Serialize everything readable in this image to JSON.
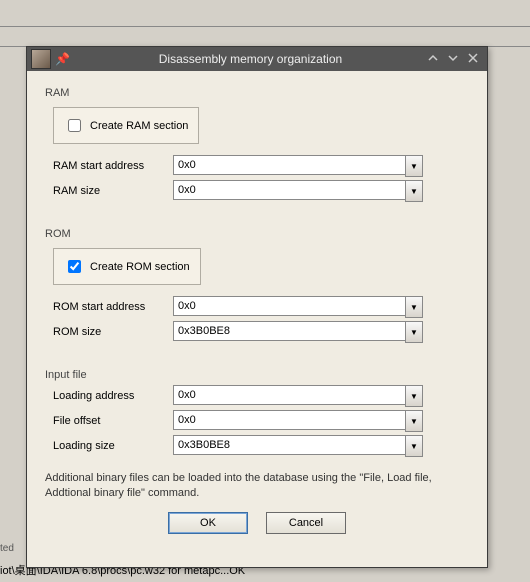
{
  "dialog": {
    "title": "Disassembly memory organization",
    "ram": {
      "label": "RAM",
      "create_label": "Create RAM section",
      "create_checked": false,
      "start_label": "RAM start address",
      "start_value": "0x0",
      "size_label": "RAM size",
      "size_value": "0x0"
    },
    "rom": {
      "label": "ROM",
      "create_label": "Create ROM section",
      "create_checked": true,
      "start_label": "ROM start address",
      "start_value": "0x0",
      "size_label": "ROM size",
      "size_value": "0x3B0BE8"
    },
    "input": {
      "label": "Input file",
      "loading_addr_label": "Loading address",
      "loading_addr_value": "0x0",
      "file_offset_label": "File offset",
      "file_offset_value": "0x0",
      "loading_size_label": "Loading size",
      "loading_size_value": "0x3B0BE8"
    },
    "info": "Additional binary files can be loaded into the database using the \"File, Load file, Addtional binary file\" command.",
    "ok_label": "OK",
    "cancel_label": "Cancel"
  },
  "bg": {
    "ted": "ted",
    "status": "iot\\桌面\\IDA\\IDA 6.8\\procs\\pc.w32 for metapc...OK"
  }
}
